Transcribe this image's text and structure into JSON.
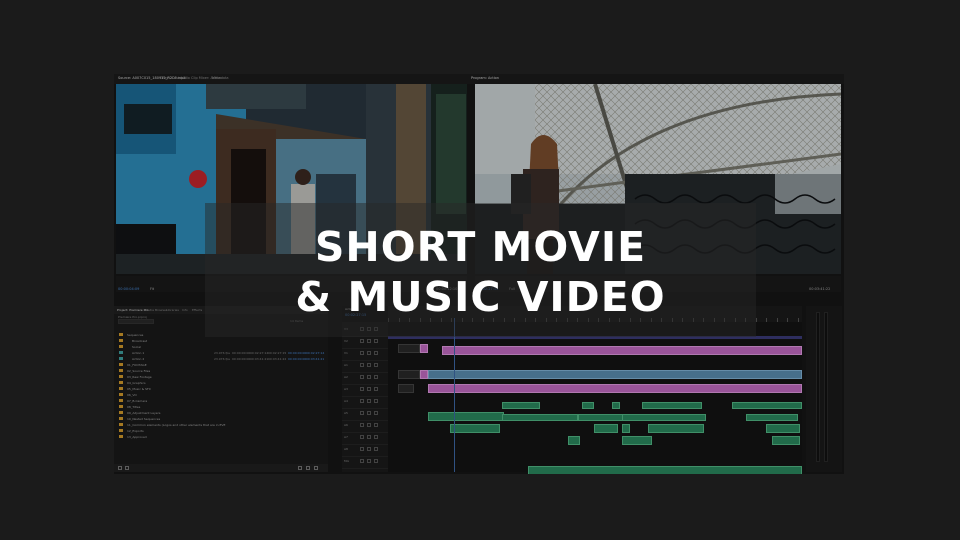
{
  "title": {
    "line1": "SHORT MOVIE",
    "line2": "& MUSIC VIDEO"
  },
  "top_tabs": {
    "source": "Source: A007C015_180912_R2C6.mp4",
    "effect_controls": "Effect Controls",
    "audio_clip_mixer": "Audio Clip Mixer: Action",
    "metadata": "Metadata",
    "program": "Program: Action"
  },
  "source_monitor": {
    "timecode": "00:00:04:09",
    "fit": "Fit",
    "duration": "00:00:12:10"
  },
  "program_monitor": {
    "timecode": "00:02:27:15",
    "fit": "Full",
    "duration": "00:03:41:22"
  },
  "project_panel": {
    "tabs": [
      "Project: Premiere Pro",
      "Media Browser",
      "Libraries",
      "Info",
      "Effects"
    ],
    "project_file": "Premiere Pro.prproj",
    "search_placeholder": "",
    "item_count": "14 Items",
    "rows": [
      {
        "label": "Sequences",
        "fps": "",
        "start": "",
        "end": "",
        "duration": "",
        "in": "",
        "out": ""
      },
      {
        "label": "Broadcast",
        "fps": "",
        "start": "",
        "end": "",
        "duration": "",
        "in": "",
        "out": ""
      },
      {
        "label": "Social",
        "fps": "",
        "start": "",
        "end": "",
        "duration": "",
        "in": "",
        "out": ""
      },
      {
        "label": "Action 1",
        "fps": "23.976 fps",
        "start": "00:00:00:00",
        "end": "00:02:27:14",
        "duration": "00:02:27:15",
        "in": "00:00:00:00",
        "out": "00:02:27:14"
      },
      {
        "label": "Action 2",
        "fps": "23.976 fps",
        "start": "00:00:00:00",
        "end": "00:03:41:21",
        "duration": "00:03:41:22",
        "in": "00:00:00:00",
        "out": "00:03:41:21"
      },
      {
        "label": "01_FOOTAGE",
        "fps": "",
        "start": "",
        "end": "",
        "duration": "",
        "in": "",
        "out": ""
      },
      {
        "label": "02_Source Files",
        "fps": "",
        "start": "",
        "end": "",
        "duration": "",
        "in": "",
        "out": ""
      },
      {
        "label": "03_Raw Footage",
        "fps": "",
        "start": "",
        "end": "",
        "duration": "",
        "in": "",
        "out": ""
      },
      {
        "label": "04_Graphics",
        "fps": "",
        "start": "",
        "end": "",
        "duration": "",
        "in": "",
        "out": ""
      },
      {
        "label": "05_Music & SFX",
        "fps": "",
        "start": "",
        "end": "",
        "duration": "",
        "in": "",
        "out": ""
      },
      {
        "label": "06_VO",
        "fps": "",
        "start": "",
        "end": "",
        "duration": "",
        "in": "",
        "out": ""
      },
      {
        "label": "07_B-Camera",
        "fps": "",
        "start": "",
        "end": "",
        "duration": "",
        "in": "",
        "out": ""
      },
      {
        "label": "08_Titles",
        "fps": "",
        "start": "",
        "end": "",
        "duration": "",
        "in": "",
        "out": ""
      },
      {
        "label": "09_Adjustment Layers",
        "fps": "",
        "start": "",
        "end": "",
        "duration": "",
        "in": "",
        "out": ""
      },
      {
        "label": "10_Nested Sequences",
        "fps": "",
        "start": "",
        "end": "",
        "duration": "",
        "in": "",
        "out": ""
      },
      {
        "label": "11_Common elements (Logos and other elements that are in EVE",
        "fps": "",
        "start": "",
        "end": "",
        "duration": "",
        "in": "",
        "out": ""
      },
      {
        "label": "12_Exports",
        "fps": "",
        "start": "",
        "end": "",
        "duration": "",
        "in": "",
        "out": ""
      },
      {
        "label": "13_Approved",
        "fps": "",
        "start": "",
        "end": "",
        "duration": "",
        "in": "",
        "out": ""
      }
    ]
  },
  "timeline": {
    "sequence_tab": "Action",
    "timecode": "00:02:27:15",
    "tracks": [
      "V3",
      "V2",
      "V1",
      "A1",
      "A2",
      "A3",
      "A4",
      "A5",
      "A6",
      "A7",
      "A8",
      "Mix"
    ]
  },
  "colors": {
    "app_bg": "#161616",
    "video_clip": "#5b8fb3",
    "pink_clip": "#c46cc4",
    "audio_clip": "#2b8a5f",
    "timecode_blue": "#4a8ee0",
    "bin_folder": "#d49b2c"
  }
}
